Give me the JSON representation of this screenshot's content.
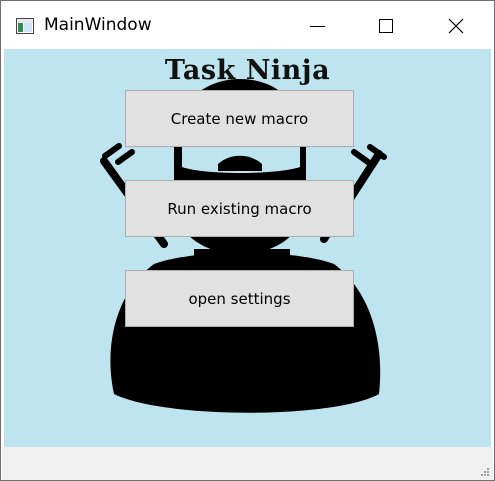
{
  "window": {
    "title": "MainWindow"
  },
  "header": {
    "title": "Task Ninja"
  },
  "buttons": {
    "create": "Create new macro",
    "run": "Run existing macro",
    "settings": "open settings"
  },
  "icons": {
    "app": "app-window-icon",
    "minimize": "minimize-icon",
    "maximize": "maximize-icon",
    "close": "close-icon",
    "illustration": "ninja-illustration",
    "grip": "resize-grip-icon"
  },
  "colors": {
    "background": "#bee5ef",
    "button": "#e1e1e1",
    "button_border": "#adadad",
    "ninja": "#000000",
    "statusbar": "#f0f0f0"
  }
}
